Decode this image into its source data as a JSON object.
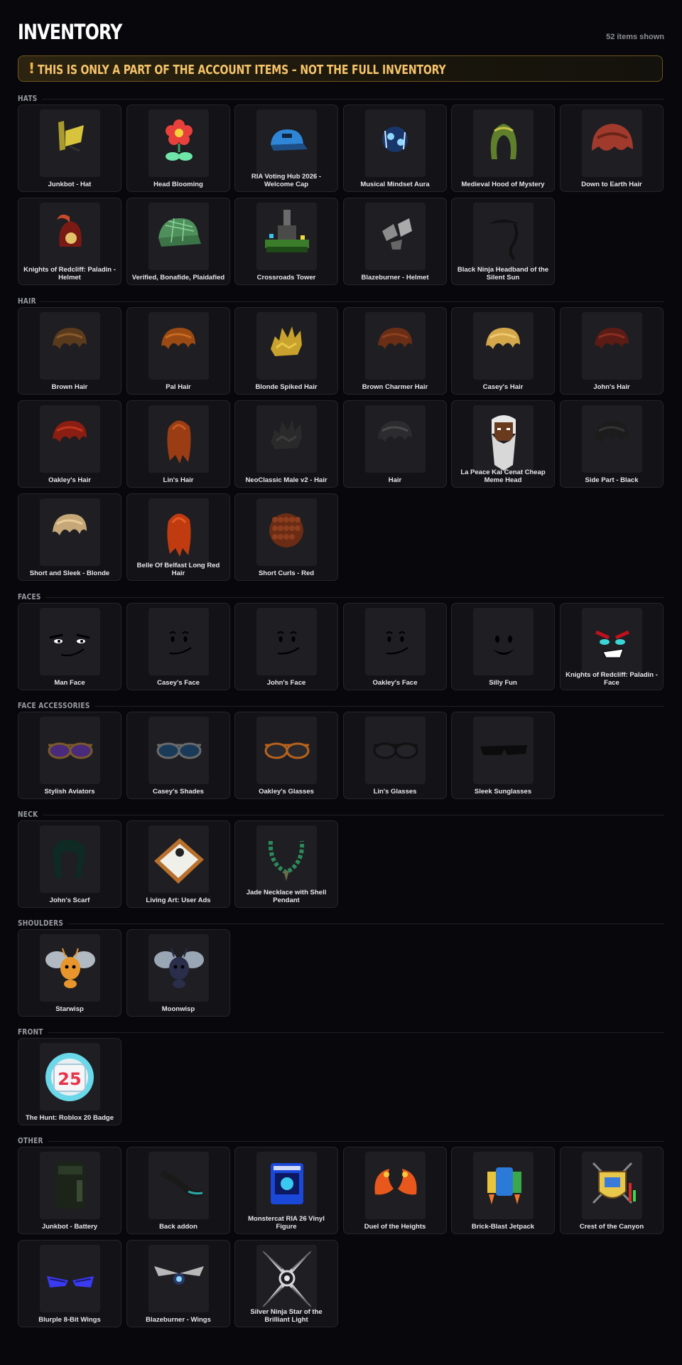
{
  "header": {
    "title": "INVENTORY",
    "count_text": "52 items shown"
  },
  "banner": {
    "icon": "!",
    "text": "THIS IS ONLY A PART OF THE ACCOUNT ITEMS – NOT THE FULL INVENTORY"
  },
  "colors": {
    "accent": "#f6c46a",
    "background": "#08080c",
    "card": "#121217"
  },
  "sections": [
    {
      "title": "HATS",
      "items": [
        {
          "name": "Junkbot - Hat",
          "icon": "junk-hat"
        },
        {
          "name": "Head Blooming",
          "icon": "flower"
        },
        {
          "name": "RIA Voting Hub 2026 - Welcome Cap",
          "icon": "blue-cap"
        },
        {
          "name": "Musical Mindset Aura",
          "icon": "music-aura"
        },
        {
          "name": "Medieval Hood of Mystery",
          "icon": "green-hood"
        },
        {
          "name": "Down to Earth Hair",
          "icon": "red-hair"
        },
        {
          "name": "Knights of Redcliff: Paladin - Helmet",
          "icon": "red-helmet"
        },
        {
          "name": "Verified, Bonafide, Plaidafied",
          "icon": "plaid-cap"
        },
        {
          "name": "Crossroads Tower",
          "icon": "tower"
        },
        {
          "name": "Blazeburner - Helmet",
          "icon": "steel-helmet"
        },
        {
          "name": "Black Ninja Headband of the Silent Sun",
          "icon": "headband"
        }
      ]
    },
    {
      "title": "HAIR",
      "items": [
        {
          "name": "Brown Hair",
          "icon": "hair-brown"
        },
        {
          "name": "Pal Hair",
          "icon": "hair-orange"
        },
        {
          "name": "Blonde Spiked Hair",
          "icon": "hair-blonde-spiked"
        },
        {
          "name": "Brown Charmer Hair",
          "icon": "hair-brown-charmer"
        },
        {
          "name": "Casey's Hair",
          "icon": "hair-blonde"
        },
        {
          "name": "John's Hair",
          "icon": "hair-auburn"
        },
        {
          "name": "Oakley's Hair",
          "icon": "hair-red"
        },
        {
          "name": "Lin's Hair",
          "icon": "hair-long-orange"
        },
        {
          "name": "NeoClassic Male v2 - Hair",
          "icon": "hair-black"
        },
        {
          "name": "Hair",
          "icon": "hair-dark"
        },
        {
          "name": "La Peace Kai Cenat Cheap Meme Head",
          "icon": "wizard-head"
        },
        {
          "name": "Side Part - Black",
          "icon": "hair-side-part"
        },
        {
          "name": "Short and Sleek - Blonde",
          "icon": "hair-sleek-blonde"
        },
        {
          "name": "Belle Of Belfast Long Red Hair",
          "icon": "hair-long-red"
        },
        {
          "name": "Short Curls - Red",
          "icon": "hair-curls"
        }
      ]
    },
    {
      "title": "FACES",
      "items": [
        {
          "name": "Man Face",
          "icon": "face-man"
        },
        {
          "name": "Casey's Face",
          "icon": "face-smirk"
        },
        {
          "name": "John's Face",
          "icon": "face-smirk"
        },
        {
          "name": "Oakley's Face",
          "icon": "face-smirk"
        },
        {
          "name": "Silly Fun",
          "icon": "face-silly"
        },
        {
          "name": "Knights of Redcliff: Paladin - Face",
          "icon": "face-paladin"
        }
      ]
    },
    {
      "title": "FACE ACCESSORIES",
      "items": [
        {
          "name": "Stylish Aviators",
          "icon": "aviators-purple"
        },
        {
          "name": "Casey's Shades",
          "icon": "aviators-blue"
        },
        {
          "name": "Oakley's Glasses",
          "icon": "glasses-orange"
        },
        {
          "name": "Lin's Glasses",
          "icon": "glasses-black"
        },
        {
          "name": "Sleek Sunglasses",
          "icon": "sunglasses-sleek"
        }
      ]
    },
    {
      "title": "NECK",
      "items": [
        {
          "name": "John's Scarf",
          "icon": "scarf"
        },
        {
          "name": "Living Art: User Ads",
          "icon": "framed-art"
        },
        {
          "name": "Jade Necklace with Shell Pendant",
          "icon": "necklace"
        }
      ]
    },
    {
      "title": "SHOULDERS",
      "items": [
        {
          "name": "Starwisp",
          "icon": "wisp-orange"
        },
        {
          "name": "Moonwisp",
          "icon": "wisp-dark"
        }
      ]
    },
    {
      "title": "FRONT",
      "items": [
        {
          "name": "The Hunt: Roblox 20 Badge",
          "icon": "badge-25",
          "badge_text": "25"
        }
      ]
    },
    {
      "title": "OTHER",
      "items": [
        {
          "name": "Junkbot - Battery",
          "icon": "battery"
        },
        {
          "name": "Back addon",
          "icon": "back-addon"
        },
        {
          "name": "Monstercat RIA 26 Vinyl Figure",
          "icon": "vinyl-box"
        },
        {
          "name": "Duel of the Heights",
          "icon": "dragons"
        },
        {
          "name": "Brick-Blast Jetpack",
          "icon": "jetpack"
        },
        {
          "name": "Crest of the Canyon",
          "icon": "crest"
        },
        {
          "name": "Blurple 8-Bit Wings",
          "icon": "wings-blurple"
        },
        {
          "name": "Blazeburner - Wings",
          "icon": "wings-blaze"
        },
        {
          "name": "Silver Ninja Star of the Brilliant Light",
          "icon": "ninja-star"
        }
      ]
    }
  ]
}
